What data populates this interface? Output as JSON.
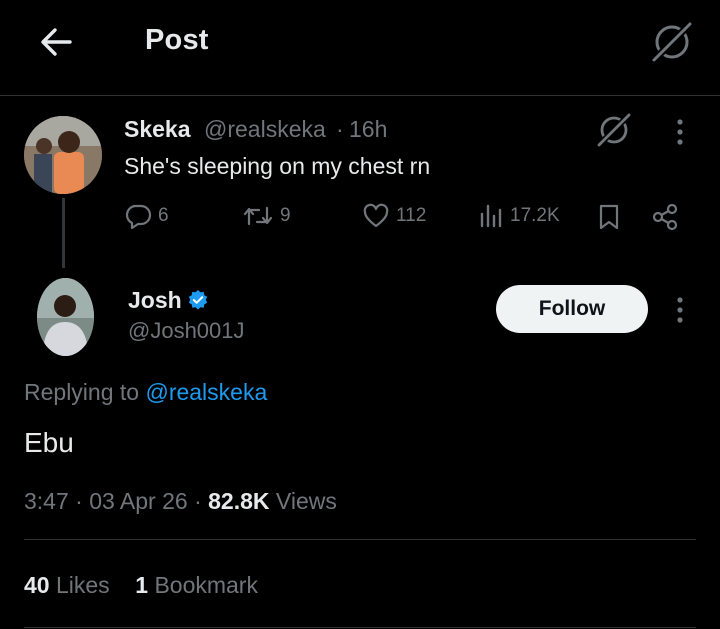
{
  "header": {
    "title": "Post",
    "back_icon": "arrow-left-icon",
    "grok_icon": "grok-icon"
  },
  "parent_post": {
    "name": "Skeka",
    "handle": "@realskeka",
    "separator": "·",
    "time": "16h",
    "text": "She's sleeping on my chest rn",
    "actions": {
      "replies": "6",
      "reposts": "9",
      "likes": "112",
      "views": "17.2K"
    }
  },
  "reply_post": {
    "name": "Josh",
    "handle": "@Josh001J",
    "verified": true,
    "verified_color": "#1d9bf0",
    "follow_label": "Follow",
    "replying_prefix": "Replying to",
    "replying_handle": "@realskeka",
    "text": "Ebu",
    "time": "3:47",
    "date": "03 Apr 26",
    "dot": "·",
    "views_count": "82.8K",
    "views_label": "Views",
    "likes_count": "40",
    "likes_label": "Likes",
    "bookmarks_count": "1",
    "bookmarks_label": "Bookmark"
  },
  "colors": {
    "background": "#000000",
    "text": "#e7e9ea",
    "muted": "#71767b",
    "accent": "#1d9bf0",
    "divider": "#2f3336"
  }
}
